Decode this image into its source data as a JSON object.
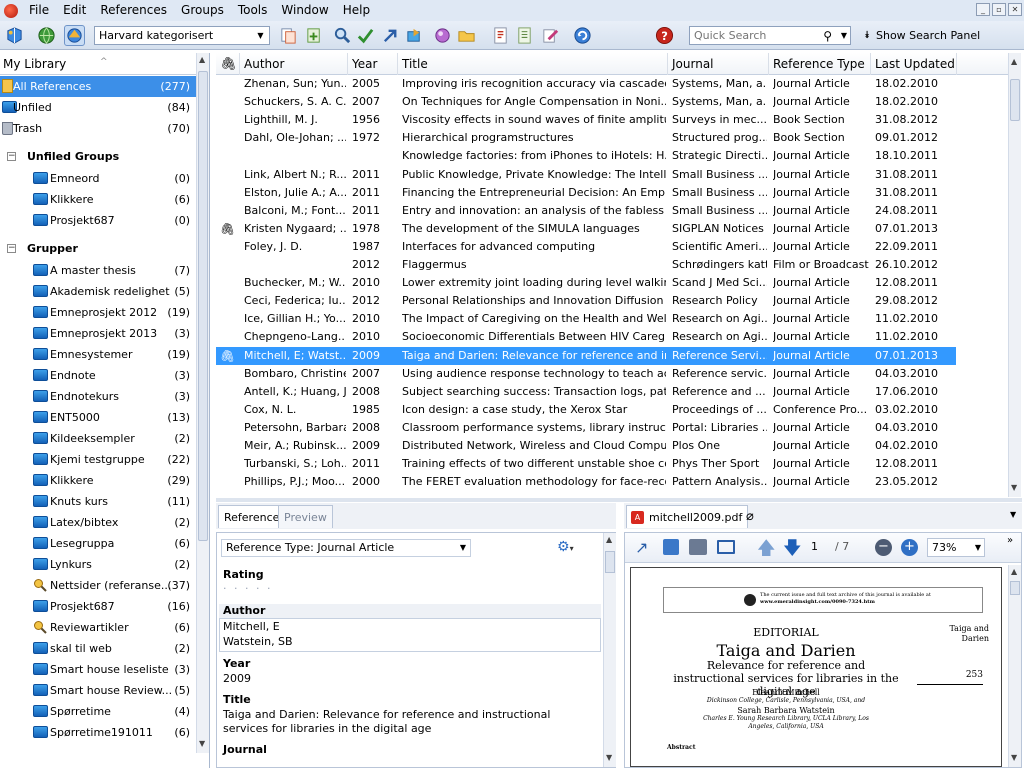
{
  "menu": [
    "File",
    "Edit",
    "References",
    "Groups",
    "Tools",
    "Window",
    "Help"
  ],
  "toolbar": {
    "style": "Harvard kategorisert",
    "quick_search_placeholder": "Quick Search",
    "show_search_panel": "Show Search Panel"
  },
  "library": {
    "header": "My Library",
    "items": [
      {
        "label": "All References",
        "count": "(277)"
      },
      {
        "label": "Unfiled",
        "count": "(84)"
      },
      {
        "label": "Trash",
        "count": "(70)"
      }
    ],
    "unfiled_groups_label": "Unfiled Groups",
    "unfiled_groups": [
      {
        "label": "Emneord",
        "count": "(0)"
      },
      {
        "label": "Klikkere",
        "count": "(6)"
      },
      {
        "label": "Prosjekt687",
        "count": "(0)"
      }
    ],
    "grupper_label": "Grupper",
    "grupper": [
      {
        "label": "A master thesis",
        "count": "(7)",
        "icon": "folder"
      },
      {
        "label": "Akademisk redelighet",
        "count": "(5)",
        "icon": "folder"
      },
      {
        "label": "Emneprosjekt 2012",
        "count": "(19)",
        "icon": "folder"
      },
      {
        "label": "Emneprosjekt 2013",
        "count": "(3)",
        "icon": "folder"
      },
      {
        "label": "Emnesystemer",
        "count": "(19)",
        "icon": "folder"
      },
      {
        "label": "Endnote",
        "count": "(3)",
        "icon": "folder"
      },
      {
        "label": "Endnotekurs",
        "count": "(3)",
        "icon": "folder"
      },
      {
        "label": "ENT5000",
        "count": "(13)",
        "icon": "folder"
      },
      {
        "label": "Kildeeksempler",
        "count": "(2)",
        "icon": "folder"
      },
      {
        "label": "Kjemi testgruppe",
        "count": "(22)",
        "icon": "folder"
      },
      {
        "label": "Klikkere",
        "count": "(29)",
        "icon": "folder"
      },
      {
        "label": "Knuts kurs",
        "count": "(11)",
        "icon": "folder"
      },
      {
        "label": "Latex/bibtex",
        "count": "(2)",
        "icon": "folder"
      },
      {
        "label": "Lesegruppa",
        "count": "(6)",
        "icon": "folder"
      },
      {
        "label": "Lynkurs",
        "count": "(2)",
        "icon": "folder"
      },
      {
        "label": "Nettsider (referanse...",
        "count": "(37)",
        "icon": "smart"
      },
      {
        "label": "Prosjekt687",
        "count": "(16)",
        "icon": "folder"
      },
      {
        "label": "Reviewartikler",
        "count": "(6)",
        "icon": "smart"
      },
      {
        "label": "skal til web",
        "count": "(2)",
        "icon": "folder"
      },
      {
        "label": "Smart house leseliste",
        "count": "(3)",
        "icon": "folder"
      },
      {
        "label": "Smart house Review...",
        "count": "(5)",
        "icon": "folder"
      },
      {
        "label": "Spørretime",
        "count": "(4)",
        "icon": "folder"
      },
      {
        "label": "Spørretime191011",
        "count": "(6)",
        "icon": "folder"
      }
    ]
  },
  "columns": [
    "Author",
    "Year",
    "Title",
    "Journal",
    "Reference Type",
    "Last Updated"
  ],
  "references": [
    {
      "attach": false,
      "author": "Zhenan, Sun; Yun...",
      "year": "2005",
      "title": "Improving iris recognition accuracy via cascaded...",
      "journal": "Systems, Man, a...",
      "type": "Journal Article",
      "updated": "18.02.2010"
    },
    {
      "attach": false,
      "author": "Schuckers, S. A. C...",
      "year": "2007",
      "title": "On Techniques for Angle Compensation in Noni...",
      "journal": "Systems, Man, a...",
      "type": "Journal Article",
      "updated": "18.02.2010"
    },
    {
      "attach": false,
      "author": "Lighthill, M. J.",
      "year": "1956",
      "title": "Viscosity effects in sound waves of finite amplitu...",
      "journal": "Surveys in mec...",
      "type": "Book Section",
      "updated": "31.08.2012"
    },
    {
      "attach": false,
      "author": "Dahl, Ole-Johan; ...",
      "year": "1972",
      "title": "Hierarchical programstructures",
      "journal": "Structured prog...",
      "type": "Book Section",
      "updated": "09.01.2012"
    },
    {
      "attach": false,
      "author": "",
      "year": "",
      "title": "Knowledge factories: from iPhones to iHotels: H...",
      "journal": "Strategic Directi...",
      "type": "Journal Article",
      "updated": "18.10.2011"
    },
    {
      "attach": false,
      "author": "Link, Albert N.; R...",
      "year": "2011",
      "title": "Public Knowledge, Private Knowledge: The Intell...",
      "journal": "Small Business ...",
      "type": "Journal Article",
      "updated": "31.08.2011"
    },
    {
      "attach": false,
      "author": "Elston, Julie A.; A...",
      "year": "2011",
      "title": "Financing the Entrepreneurial Decision: An Empir...",
      "journal": "Small Business ...",
      "type": "Journal Article",
      "updated": "31.08.2011"
    },
    {
      "attach": false,
      "author": "Balconi, M.; Font...",
      "year": "2011",
      "title": "Entry and innovation: an analysis of the fabless s...",
      "journal": "Small Business ...",
      "type": "Journal Article",
      "updated": "24.08.2011"
    },
    {
      "attach": true,
      "author": "Kristen Nygaard; ...",
      "year": "1978",
      "title": "The development of the SIMULA languages",
      "journal": "SIGPLAN Notices",
      "type": "Journal Article",
      "updated": "07.01.2013"
    },
    {
      "attach": false,
      "author": "Foley, J. D.",
      "year": "1987",
      "title": "Interfaces for advanced computing",
      "journal": "Scientific Ameri...",
      "type": "Journal Article",
      "updated": "22.09.2011"
    },
    {
      "attach": false,
      "author": "",
      "year": "2012",
      "title": "Flaggermus",
      "journal": "Schrødingers katt",
      "type": "Film or Broadcast",
      "updated": "26.10.2012"
    },
    {
      "attach": false,
      "author": "Buchecker, M.; W...",
      "year": "2010",
      "title": "Lower extremity joint loading during level walkin...",
      "journal": "Scand J Med Sci...",
      "type": "Journal Article",
      "updated": "12.08.2011"
    },
    {
      "attach": false,
      "author": "Ceci, Federica; Iu...",
      "year": "2012",
      "title": "Personal Relationships and Innovation Diffusion i...",
      "journal": "Research Policy",
      "type": "Journal Article",
      "updated": "29.08.2012"
    },
    {
      "attach": false,
      "author": "Ice, Gillian H.; Yo...",
      "year": "2010",
      "title": "The Impact of Caregiving on the Health and Well...",
      "journal": "Research on Agi...",
      "type": "Journal Article",
      "updated": "11.02.2010"
    },
    {
      "attach": false,
      "author": "Chepngeno-Lang...",
      "year": "2010",
      "title": "Socioeconomic Differentials Between HIV Caregi...",
      "journal": "Research on Agi...",
      "type": "Journal Article",
      "updated": "11.02.2010"
    },
    {
      "attach": true,
      "author": "Mitchell, E; Watst...",
      "year": "2009",
      "title": "Taiga and Darien: Relevance for reference and ins...",
      "journal": "Reference Servi...",
      "type": "Journal Article",
      "updated": "07.01.2013"
    },
    {
      "attach": false,
      "author": "Bombaro, Christine",
      "year": "2007",
      "title": "Using audience response technology to teach ac...",
      "journal": "Reference servic...",
      "type": "Journal Article",
      "updated": "04.03.2010"
    },
    {
      "attach": false,
      "author": "Antell, K.; Huang, J.",
      "year": "2008",
      "title": "Subject searching success: Transaction logs, patr...",
      "journal": "Reference and ...",
      "type": "Journal Article",
      "updated": "17.06.2010"
    },
    {
      "attach": false,
      "author": "Cox, N. L.",
      "year": "1985",
      "title": "Icon design: a case study, the Xerox Star",
      "journal": "Proceedings of ...",
      "type": "Conference Pro...",
      "updated": "03.02.2010"
    },
    {
      "attach": false,
      "author": "Petersohn, Barbara",
      "year": "2008",
      "title": "Classroom performance systems, library instructi...",
      "journal": "Portal: Libraries ...",
      "type": "Journal Article",
      "updated": "04.03.2010"
    },
    {
      "attach": false,
      "author": "Meir, A.; Rubinsk...",
      "year": "2009",
      "title": "Distributed Network, Wireless and Cloud Compu...",
      "journal": "Plos One",
      "type": "Journal Article",
      "updated": "04.02.2010"
    },
    {
      "attach": false,
      "author": "Turbanski, S.; Loh...",
      "year": "2011",
      "title": "Training effects of two different unstable shoe co...",
      "journal": "Phys Ther Sport",
      "type": "Journal Article",
      "updated": "12.08.2011"
    },
    {
      "attach": false,
      "author": "Phillips, P.J.; Moo...",
      "year": "2000",
      "title": "The FERET evaluation methodology for face-reco...",
      "journal": "Pattern Analysis...",
      "type": "Journal Article",
      "updated": "23.05.2012"
    }
  ],
  "detail": {
    "tab_reference": "Reference",
    "tab_preview": "Preview",
    "ref_type_label": "Reference Type:",
    "ref_type_value": "Journal Article",
    "rating_label": "Rating",
    "rating_dots": "· · · · ·",
    "author_label": "Author",
    "authors": [
      "Mitchell, E",
      "Watstein, SB"
    ],
    "year_label": "Year",
    "year": "2009",
    "title_label": "Title",
    "title": "Taiga and Darien: Relevance for reference and instructional services for libraries in the digital age",
    "journal_label": "Journal"
  },
  "pdf": {
    "tab_label": "mitchell2009.pdf",
    "page": "1",
    "pages": "/ 7",
    "zoom": "73%",
    "doc": {
      "notice": "The current issue and full text archive of this journal is available at",
      "url": "www.emeraldinsight.com/0090-7324.htm",
      "section": "EDITORIAL",
      "title": "Taiga and Darien",
      "subtitle": "Relevance for reference and instructional services for libraries in the digital age",
      "author1": "Eleanor Mitchell",
      "affil1": "Dickinson College, Carlisle, Pennsylvania, USA, and",
      "author2": "Sarah Barbara Watstein",
      "affil2": "Charles E. Young Research Library, UCLA Library, Los Angeles, California, USA",
      "side_title": "Taiga and Darien",
      "page_number": "253",
      "abstract": "Abstract"
    }
  }
}
